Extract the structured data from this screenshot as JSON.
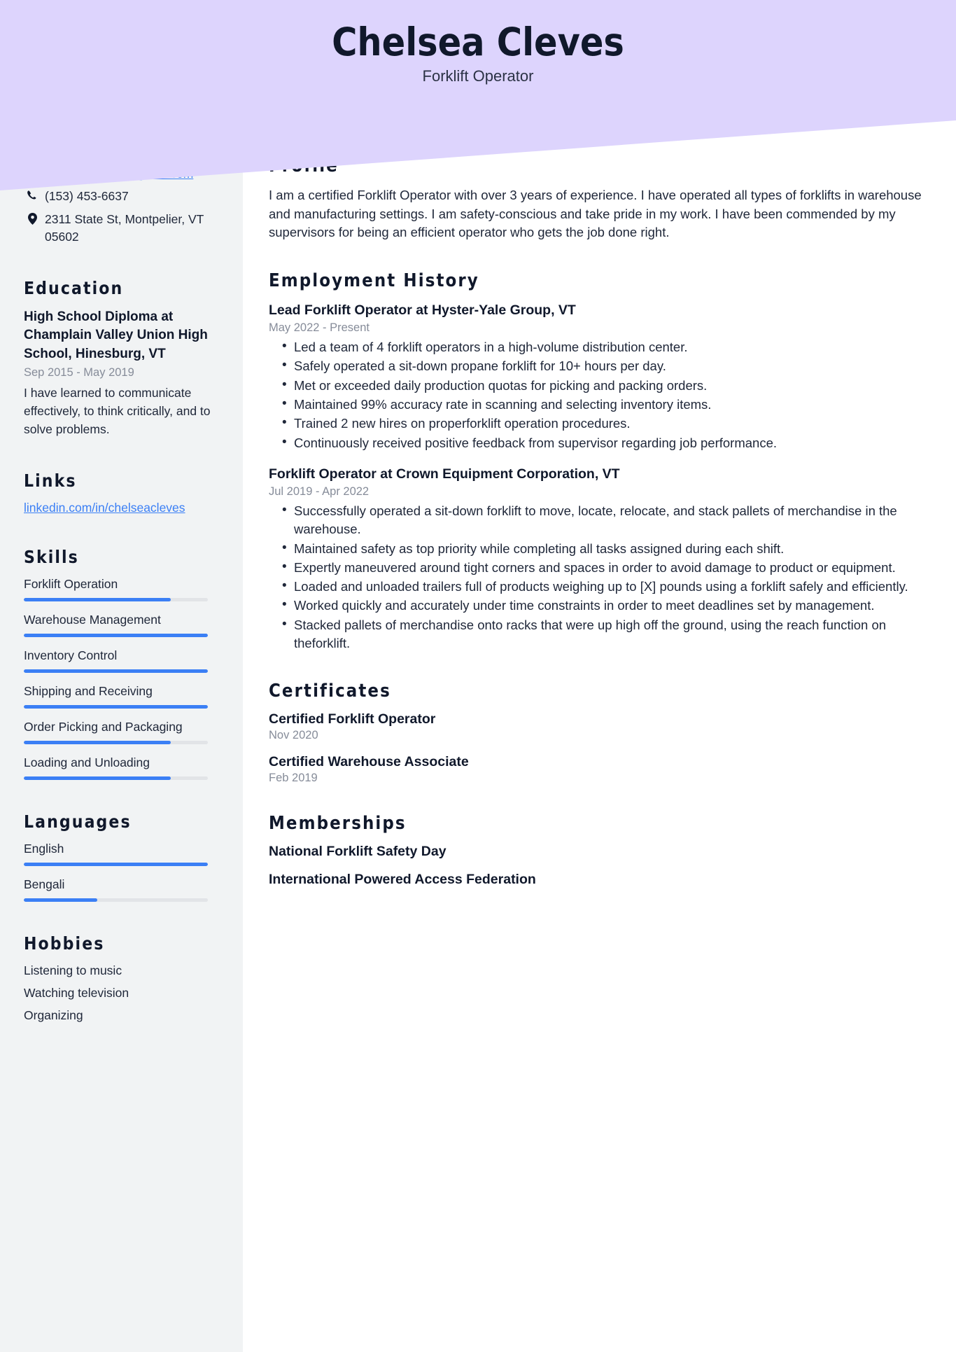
{
  "header": {
    "name": "Chelsea Cleves",
    "role": "Forklift Operator",
    "band_color": "#ddd4fd"
  },
  "theme": {
    "accent": "#3b7ff5",
    "sidebar_bg": "#f1f3f4",
    "text": "#20283a",
    "muted": "#868c99"
  },
  "sidebar": {
    "contact": {
      "email": "chelsea.cleves@gmail.com",
      "phone": "(153) 453-6637",
      "address": "2311 State St, Montpelier, VT 05602",
      "icons": [
        "envelope-icon",
        "phone-icon",
        "location-pin-icon"
      ]
    },
    "education": {
      "title": "Education",
      "items": [
        {
          "degree": "High School Diploma at Champlain Valley Union High School, Hinesburg, VT",
          "date": "Sep 2015 - May 2019",
          "description": "I have learned to communicate effectively, to think critically, and to solve problems."
        }
      ]
    },
    "links": {
      "title": "Links",
      "items": [
        {
          "label": "linkedin.com/in/chelseacleves"
        }
      ]
    },
    "skills": {
      "title": "Skills",
      "items": [
        {
          "label": "Forklift Operation",
          "level": 80
        },
        {
          "label": "Warehouse Management",
          "level": 100
        },
        {
          "label": "Inventory Control",
          "level": 100
        },
        {
          "label": "Shipping and Receiving",
          "level": 100
        },
        {
          "label": "Order Picking and Packaging",
          "level": 80
        },
        {
          "label": "Loading and Unloading",
          "level": 80
        }
      ]
    },
    "languages": {
      "title": "Languages",
      "items": [
        {
          "label": "English",
          "level": 100
        },
        {
          "label": "Bengali",
          "level": 40
        }
      ]
    },
    "hobbies": {
      "title": "Hobbies",
      "items": [
        {
          "label": "Listening to music"
        },
        {
          "label": "Watching television"
        },
        {
          "label": "Organizing"
        }
      ]
    }
  },
  "main": {
    "profile": {
      "title": "Profile",
      "text": "I am a certified Forklift Operator with over 3 years of experience. I have operated all types of forklifts in warehouse and manufacturing settings. I am safety-conscious and take pride in my work. I have been commended by my supervisors for being an efficient operator who gets the job done right."
    },
    "employment": {
      "title": "Employment History",
      "jobs": [
        {
          "title": "Lead Forklift Operator at Hyster-Yale Group, VT",
          "date": "May 2022 - Present",
          "bullets": [
            "Led a team of 4 forklift operators in a high-volume distribution center.",
            "Safely operated a sit-down propane forklift for 10+ hours per day.",
            "Met or exceeded daily production quotas for picking and packing orders.",
            "Maintained 99% accuracy rate in scanning and selecting inventory items.",
            "Trained 2 new hires on properforklift operation procedures.",
            "Continuously received positive feedback from supervisor regarding job performance."
          ]
        },
        {
          "title": "Forklift Operator at Crown Equipment Corporation, VT",
          "date": "Jul 2019 - Apr 2022",
          "bullets": [
            "Successfully operated a sit-down forklift to move, locate, relocate, and stack pallets of merchandise in the warehouse.",
            "Maintained safety as top priority while completing all tasks assigned during each shift.",
            "Expertly maneuvered around tight corners and spaces in order to avoid damage to product or equipment.",
            "Loaded and unloaded trailers full of products weighing up to [X] pounds using a forklift safely and efficiently.",
            "Worked quickly and accurately under time constraints in order to meet deadlines set by management.",
            "Stacked pallets of merchandise onto racks that were up high off the ground, using the reach function on theforklift."
          ]
        }
      ]
    },
    "certificates": {
      "title": "Certificates",
      "items": [
        {
          "name": "Certified Forklift Operator",
          "date": "Nov 2020"
        },
        {
          "name": "Certified Warehouse Associate",
          "date": "Feb 2019"
        }
      ]
    },
    "memberships": {
      "title": "Memberships",
      "items": [
        {
          "name": "National Forklift Safety Day"
        },
        {
          "name": "International Powered Access Federation"
        }
      ]
    }
  }
}
